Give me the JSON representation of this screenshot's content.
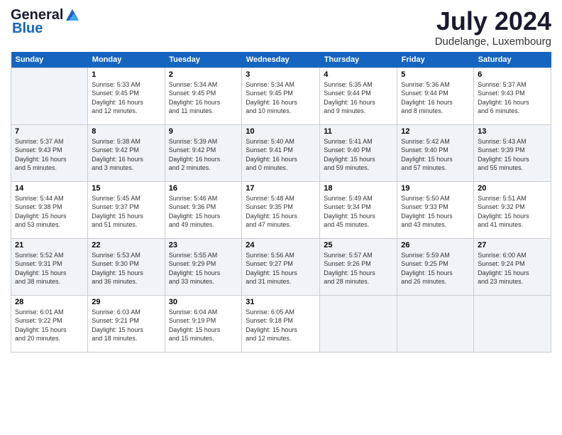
{
  "logo": {
    "general": "General",
    "blue": "Blue"
  },
  "header": {
    "month_year": "July 2024",
    "location": "Dudelange, Luxembourg"
  },
  "weekdays": [
    "Sunday",
    "Monday",
    "Tuesday",
    "Wednesday",
    "Thursday",
    "Friday",
    "Saturday"
  ],
  "weeks": [
    [
      {
        "day": "",
        "info": ""
      },
      {
        "day": "1",
        "info": "Sunrise: 5:33 AM\nSunset: 9:45 PM\nDaylight: 16 hours\nand 12 minutes."
      },
      {
        "day": "2",
        "info": "Sunrise: 5:34 AM\nSunset: 9:45 PM\nDaylight: 16 hours\nand 11 minutes."
      },
      {
        "day": "3",
        "info": "Sunrise: 5:34 AM\nSunset: 9:45 PM\nDaylight: 16 hours\nand 10 minutes."
      },
      {
        "day": "4",
        "info": "Sunrise: 5:35 AM\nSunset: 9:44 PM\nDaylight: 16 hours\nand 9 minutes."
      },
      {
        "day": "5",
        "info": "Sunrise: 5:36 AM\nSunset: 9:44 PM\nDaylight: 16 hours\nand 8 minutes."
      },
      {
        "day": "6",
        "info": "Sunrise: 5:37 AM\nSunset: 9:43 PM\nDaylight: 16 hours\nand 6 minutes."
      }
    ],
    [
      {
        "day": "7",
        "info": "Sunrise: 5:37 AM\nSunset: 9:43 PM\nDaylight: 16 hours\nand 5 minutes."
      },
      {
        "day": "8",
        "info": "Sunrise: 5:38 AM\nSunset: 9:42 PM\nDaylight: 16 hours\nand 3 minutes."
      },
      {
        "day": "9",
        "info": "Sunrise: 5:39 AM\nSunset: 9:42 PM\nDaylight: 16 hours\nand 2 minutes."
      },
      {
        "day": "10",
        "info": "Sunrise: 5:40 AM\nSunset: 9:41 PM\nDaylight: 16 hours\nand 0 minutes."
      },
      {
        "day": "11",
        "info": "Sunrise: 5:41 AM\nSunset: 9:40 PM\nDaylight: 15 hours\nand 59 minutes."
      },
      {
        "day": "12",
        "info": "Sunrise: 5:42 AM\nSunset: 9:40 PM\nDaylight: 15 hours\nand 57 minutes."
      },
      {
        "day": "13",
        "info": "Sunrise: 5:43 AM\nSunset: 9:39 PM\nDaylight: 15 hours\nand 55 minutes."
      }
    ],
    [
      {
        "day": "14",
        "info": "Sunrise: 5:44 AM\nSunset: 9:38 PM\nDaylight: 15 hours\nand 53 minutes."
      },
      {
        "day": "15",
        "info": "Sunrise: 5:45 AM\nSunset: 9:37 PM\nDaylight: 15 hours\nand 51 minutes."
      },
      {
        "day": "16",
        "info": "Sunrise: 5:46 AM\nSunset: 9:36 PM\nDaylight: 15 hours\nand 49 minutes."
      },
      {
        "day": "17",
        "info": "Sunrise: 5:48 AM\nSunset: 9:35 PM\nDaylight: 15 hours\nand 47 minutes."
      },
      {
        "day": "18",
        "info": "Sunrise: 5:49 AM\nSunset: 9:34 PM\nDaylight: 15 hours\nand 45 minutes."
      },
      {
        "day": "19",
        "info": "Sunrise: 5:50 AM\nSunset: 9:33 PM\nDaylight: 15 hours\nand 43 minutes."
      },
      {
        "day": "20",
        "info": "Sunrise: 5:51 AM\nSunset: 9:32 PM\nDaylight: 15 hours\nand 41 minutes."
      }
    ],
    [
      {
        "day": "21",
        "info": "Sunrise: 5:52 AM\nSunset: 9:31 PM\nDaylight: 15 hours\nand 38 minutes."
      },
      {
        "day": "22",
        "info": "Sunrise: 5:53 AM\nSunset: 9:30 PM\nDaylight: 15 hours\nand 36 minutes."
      },
      {
        "day": "23",
        "info": "Sunrise: 5:55 AM\nSunset: 9:29 PM\nDaylight: 15 hours\nand 33 minutes."
      },
      {
        "day": "24",
        "info": "Sunrise: 5:56 AM\nSunset: 9:27 PM\nDaylight: 15 hours\nand 31 minutes."
      },
      {
        "day": "25",
        "info": "Sunrise: 5:57 AM\nSunset: 9:26 PM\nDaylight: 15 hours\nand 28 minutes."
      },
      {
        "day": "26",
        "info": "Sunrise: 5:59 AM\nSunset: 9:25 PM\nDaylight: 15 hours\nand 26 minutes."
      },
      {
        "day": "27",
        "info": "Sunrise: 6:00 AM\nSunset: 9:24 PM\nDaylight: 15 hours\nand 23 minutes."
      }
    ],
    [
      {
        "day": "28",
        "info": "Sunrise: 6:01 AM\nSunset: 9:22 PM\nDaylight: 15 hours\nand 20 minutes."
      },
      {
        "day": "29",
        "info": "Sunrise: 6:03 AM\nSunset: 9:21 PM\nDaylight: 15 hours\nand 18 minutes."
      },
      {
        "day": "30",
        "info": "Sunrise: 6:04 AM\nSunset: 9:19 PM\nDaylight: 15 hours\nand 15 minutes."
      },
      {
        "day": "31",
        "info": "Sunrise: 6:05 AM\nSunset: 9:18 PM\nDaylight: 15 hours\nand 12 minutes."
      },
      {
        "day": "",
        "info": ""
      },
      {
        "day": "",
        "info": ""
      },
      {
        "day": "",
        "info": ""
      }
    ]
  ]
}
